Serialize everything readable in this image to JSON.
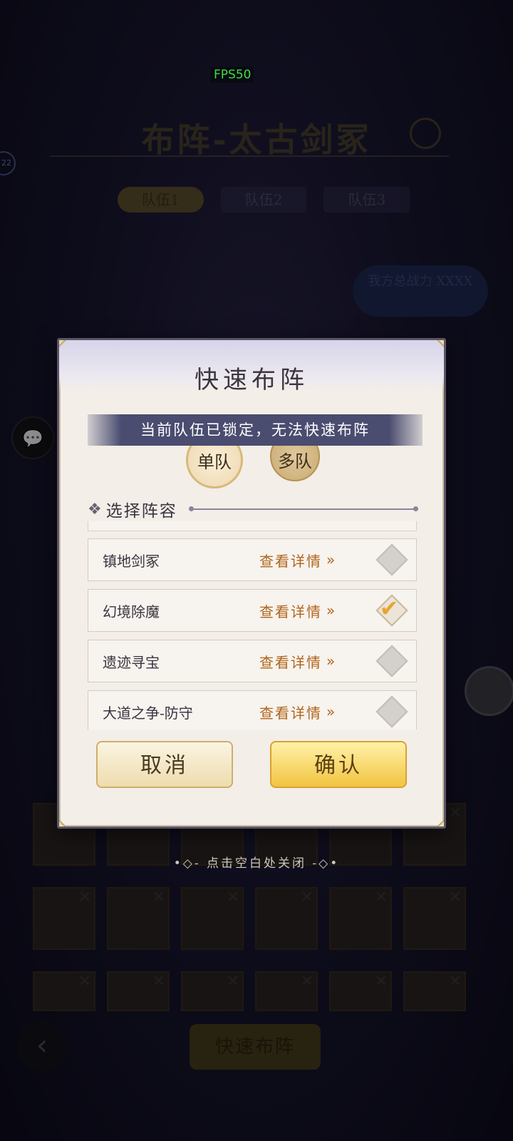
{
  "overlay": {
    "fps": "FPS50"
  },
  "background": {
    "title": "布阵-太古剑冢",
    "side_badge": "22",
    "tabs": [
      "队伍1",
      "队伍2",
      "队伍3"
    ],
    "power": "我方总战力 XXXX",
    "quick_formation_label": "快速布阵"
  },
  "modal": {
    "title": "快速布阵",
    "lock_notice": "当前队伍已锁定，无法快速布阵",
    "modes": {
      "single": "单队",
      "multi": "多队"
    },
    "section_title": "选择阵容",
    "lineups": [
      {
        "name": "镇地剑冢",
        "detail": "查看详情",
        "selected": false
      },
      {
        "name": "幻境除魔",
        "detail": "查看详情",
        "selected": true
      },
      {
        "name": "遗迹寻宝",
        "detail": "查看详情",
        "selected": false
      },
      {
        "name": "大道之争-防守",
        "detail": "查看详情",
        "selected": false
      }
    ],
    "cancel": "取消",
    "confirm": "确认"
  },
  "close_hint": "•◇- 点击空白处关闭 -◇•",
  "colors": {
    "accent": "#b0651c",
    "banner": "#4a4c70",
    "confirm": "#f2c440"
  }
}
